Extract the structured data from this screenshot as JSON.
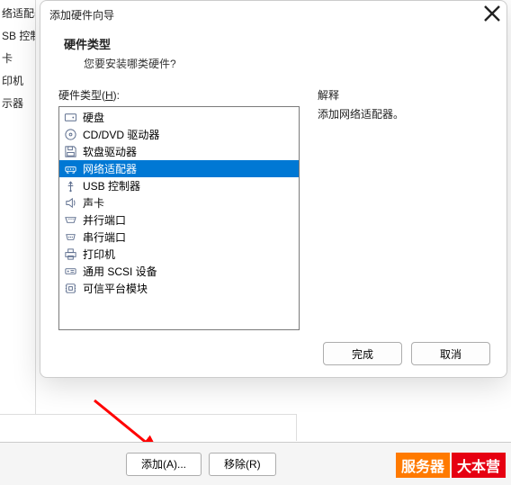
{
  "bg_sidebar": {
    "items": [
      "络适配器",
      "SB 控制器",
      "卡",
      "印机",
      "示器"
    ]
  },
  "dialog": {
    "title": "添加硬件向导",
    "header": {
      "title": "硬件类型",
      "subtitle": "您要安装哪类硬件?"
    },
    "list_label_prefix": "硬件类型(",
    "list_label_hotkey": "H",
    "list_label_suffix": "):",
    "explain_label": "解释",
    "explain_text": "添加网络适配器。",
    "items": [
      {
        "icon": "disk-icon",
        "label": "硬盘",
        "selected": false
      },
      {
        "icon": "cd-icon",
        "label": "CD/DVD 驱动器",
        "selected": false
      },
      {
        "icon": "floppy-icon",
        "label": "软盘驱动器",
        "selected": false
      },
      {
        "icon": "network-icon",
        "label": "网络适配器",
        "selected": true
      },
      {
        "icon": "usb-icon",
        "label": "USB 控制器",
        "selected": false
      },
      {
        "icon": "sound-icon",
        "label": "声卡",
        "selected": false
      },
      {
        "icon": "parallel-icon",
        "label": "并行端口",
        "selected": false
      },
      {
        "icon": "serial-icon",
        "label": "串行端口",
        "selected": false
      },
      {
        "icon": "printer-icon",
        "label": "打印机",
        "selected": false
      },
      {
        "icon": "scsi-icon",
        "label": "通用 SCSI 设备",
        "selected": false
      },
      {
        "icon": "tpm-icon",
        "label": "可信平台模块",
        "selected": false
      }
    ],
    "footer": {
      "finish": "完成",
      "cancel": "取消"
    }
  },
  "bottom_buttons": {
    "add": "添加(A)...",
    "remove": "移除(R)"
  },
  "watermark": {
    "a": "服务器",
    "b": "大本营"
  },
  "colors": {
    "selection": "#0078d4",
    "arrow": "#ff0000"
  }
}
